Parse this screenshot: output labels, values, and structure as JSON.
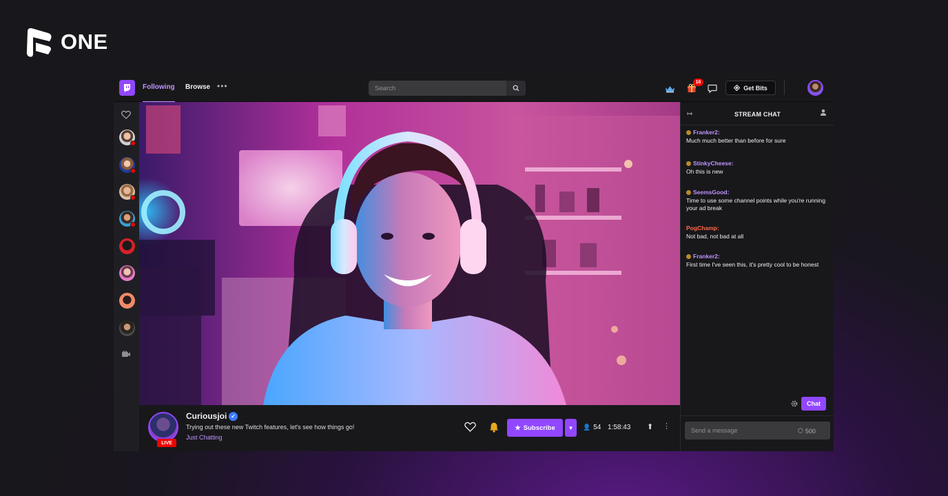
{
  "brand": {
    "name": "ONE"
  },
  "nav": {
    "following": "Following",
    "browse": "Browse",
    "more": "•••",
    "search_placeholder": "Search",
    "gift_badge": "16",
    "get_bits": "Get Bits"
  },
  "sidebar": {
    "channels": [
      {
        "live": true
      },
      {
        "live": true
      },
      {
        "live": true
      },
      {
        "live": true
      },
      {
        "live": false
      },
      {
        "live": false
      },
      {
        "live": false
      },
      {
        "live": false
      }
    ]
  },
  "stream": {
    "channel": "Curiousjoi",
    "title": "Trying out these new Twitch features, let's see how things go!",
    "category": "Just Chatting",
    "live_label": "LIVE",
    "subscribe": "Subscribe",
    "viewers": "54",
    "uptime": "1:58:43"
  },
  "chat": {
    "title": "STREAM CHAT",
    "messages": [
      {
        "user": "Franker2:",
        "text": "Much much better than before for sure",
        "color": "#bf94ff",
        "badge": true
      },
      {
        "user": "StinkyCheese:",
        "text": "Oh this is new",
        "color": "#bf94ff",
        "badge": true
      },
      {
        "user": "SeemsGood:",
        "text": "Time to use some channel points while you're running your ad break",
        "color": "#bf94ff",
        "badge": true
      },
      {
        "user": "PogChamp:",
        "text": "Not bad, not bad at all",
        "color": "#ff6b4a",
        "badge": false
      },
      {
        "user": "Franker2:",
        "text": "First time I've seen this, it's pretty cool to be honest",
        "color": "#bf94ff",
        "badge": true
      }
    ],
    "chat_button": "Chat",
    "input_placeholder": "Send a message",
    "points": "500"
  },
  "colors": {
    "accent": "#9147ff",
    "accent_light": "#bf94ff",
    "live_red": "#eb0400"
  }
}
